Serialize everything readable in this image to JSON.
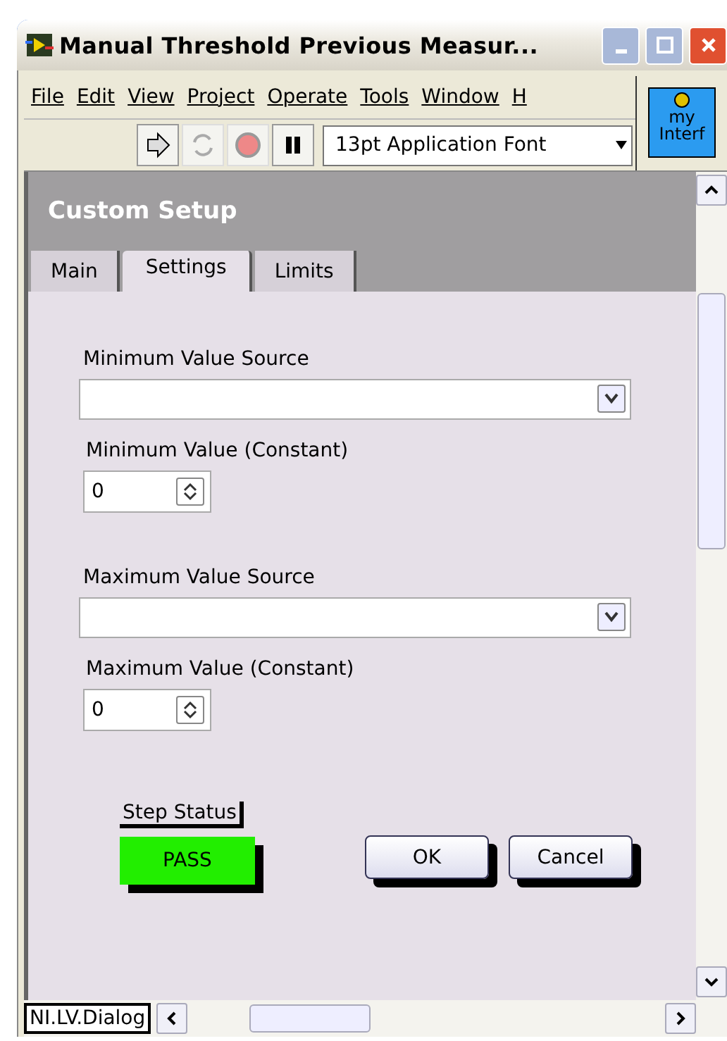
{
  "window": {
    "title": "Manual Threshold Previous Measur..."
  },
  "menu": [
    "File",
    "Edit",
    "View",
    "Project",
    "Operate",
    "Tools",
    "Window",
    "H"
  ],
  "toolbar": {
    "font_selector": "13pt Application Font",
    "vi_icon_lines": [
      "my",
      "Interf"
    ]
  },
  "panel": {
    "title": "Custom Setup"
  },
  "tabs": [
    {
      "label": "Main",
      "selected": false
    },
    {
      "label": "Settings",
      "selected": true
    },
    {
      "label": "Limits",
      "selected": false
    }
  ],
  "sections": [
    {
      "source_label": "Minimum Value Source",
      "constant_label": "Minimum Value (Constant)",
      "constant_value": "0"
    },
    {
      "source_label": "Maximum Value Source",
      "constant_label": "Maximum Value (Constant)",
      "constant_value": "0"
    }
  ],
  "step_status": {
    "label": "Step Status",
    "value": "PASS",
    "on": true
  },
  "buttons": [
    "OK",
    "Cancel"
  ],
  "status_bar": {
    "label": "NI.LV.Dialog"
  }
}
